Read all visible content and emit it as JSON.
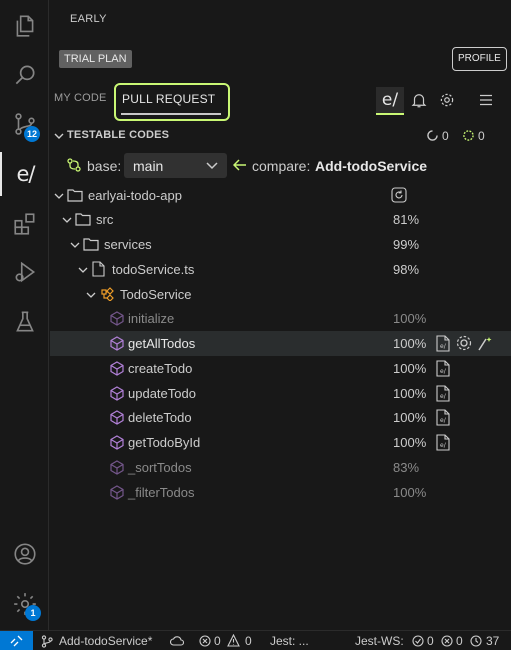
{
  "app": {
    "accent": "#0078d4",
    "highlight": "#c9f774"
  },
  "activity_bar": {
    "items": [
      {
        "icon": "files-icon"
      },
      {
        "icon": "search-icon"
      },
      {
        "icon": "source-control-icon",
        "badge": "12"
      },
      {
        "icon": "early-ai-icon",
        "glyph": "e/"
      },
      {
        "icon": "extensions-icon"
      },
      {
        "icon": "run-debug-icon"
      },
      {
        "icon": "testing-icon"
      }
    ],
    "bottom": [
      {
        "icon": "account-icon"
      },
      {
        "icon": "manage-gear-icon",
        "badge": "1"
      }
    ]
  },
  "sidebar": {
    "title": "EARLY",
    "plan_badge": "TRIAL PLAN",
    "profile_button": "PROFILE",
    "tabs": [
      {
        "label": "MY CODE",
        "active": false
      },
      {
        "label": "PULL REQUEST",
        "active": true
      }
    ],
    "toolbar": {
      "early_glyph": "e/",
      "icons": [
        "bell-icon",
        "gear-icon",
        "menu-icon"
      ]
    }
  },
  "testable": {
    "title": "TESTABLE CODES",
    "count_running": "0",
    "count_pending": "0",
    "base_label": "base:",
    "base_value": "main",
    "compare_label": "compare:",
    "compare_value": "Add-todoService"
  },
  "tree": [
    {
      "label": "earlyai-todo-app",
      "kind": "folder",
      "percent": ""
    },
    {
      "label": "src",
      "kind": "folder",
      "percent": "81%"
    },
    {
      "label": "services",
      "kind": "folder",
      "percent": "99%"
    },
    {
      "label": "todoService.ts",
      "kind": "file",
      "percent": "98%"
    },
    {
      "label": "TodoService",
      "kind": "class",
      "percent": ""
    },
    {
      "label": "initialize",
      "kind": "method",
      "percent": "100%",
      "dim": true
    },
    {
      "label": "getAllTodos",
      "kind": "method",
      "percent": "100%",
      "selected": true
    },
    {
      "label": "createTodo",
      "kind": "method",
      "percent": "100%"
    },
    {
      "label": "updateTodo",
      "kind": "method",
      "percent": "100%"
    },
    {
      "label": "deleteTodo",
      "kind": "method",
      "percent": "100%"
    },
    {
      "label": "getTodoById",
      "kind": "method",
      "percent": "100%"
    },
    {
      "label": "_sortTodos",
      "kind": "method",
      "percent": "83%",
      "dim": true
    },
    {
      "label": "_filterTodos",
      "kind": "method",
      "percent": "100%",
      "dim": true
    }
  ],
  "status_bar": {
    "branch": "Add-todoService*",
    "errors": "0",
    "warnings": "0",
    "jest": "Jest: ...",
    "jest_ws": "Jest-WS:",
    "passed": "0",
    "failed": "0",
    "tests": "37"
  }
}
